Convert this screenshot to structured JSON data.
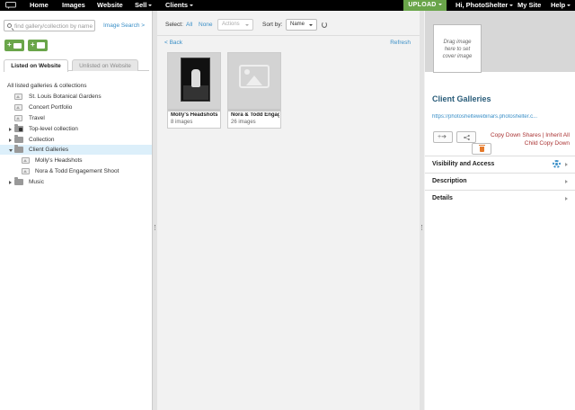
{
  "nav": {
    "items": [
      {
        "label": "Home"
      },
      {
        "label": "Images"
      },
      {
        "label": "Website"
      },
      {
        "label": "Sell"
      },
      {
        "label": "Clients"
      }
    ],
    "upload_label": "UPLOAD",
    "greeting_prefix": "Hi, ",
    "username": "PhotoShelter",
    "my_site": "My Site",
    "help": "Help"
  },
  "sidebar": {
    "search_placeholder": "find gallery/collection by name",
    "image_search": "Image Search >",
    "tabs": [
      {
        "label": "Listed on Website",
        "active": true
      },
      {
        "label": "Unlisted on Website",
        "active": false
      }
    ],
    "tree_header": "All listed galleries & collections",
    "tree": [
      {
        "label": "St. Louis Botanical Gardens",
        "type": "gallery"
      },
      {
        "label": "Concert Portfolio",
        "type": "gallery"
      },
      {
        "label": "Travel",
        "type": "gallery"
      },
      {
        "label": "Top-level collection",
        "type": "collection-locked"
      },
      {
        "label": "Collection",
        "type": "collection"
      },
      {
        "label": "Client Galleries",
        "type": "collection",
        "selected": true
      },
      {
        "label": "Molly's Headshots",
        "type": "gallery"
      },
      {
        "label": "Nora & Todd Engagement Shoot",
        "type": "gallery"
      },
      {
        "label": "Music",
        "type": "collection"
      }
    ]
  },
  "main": {
    "select_label": "Select:",
    "select_all": "All",
    "select_none": "None",
    "actions_label": "Actions",
    "sort_label": "Sort by:",
    "sort_value": "Name",
    "back": "< Back",
    "refresh": "Refresh",
    "cards": [
      {
        "title": "Molly's Headshots",
        "count": "8 images"
      },
      {
        "title": "Nora & Todd Engag...",
        "count": "26 images"
      }
    ]
  },
  "detail": {
    "cover_text": "Drag image here to set cover image",
    "title": "Client Galleries",
    "url": "https://photosheltewebinars.photoshelter.c...",
    "copy_line1": "Copy Down Shares | Inherit All",
    "copy_line2": "Child Copy Down",
    "sections": [
      {
        "label": "Visibility and Access"
      },
      {
        "label": "Description"
      },
      {
        "label": "Details"
      }
    ]
  },
  "colors": {
    "accent": "#6aa54a",
    "link": "#3a8fc7",
    "selected_row": "#dceffa",
    "title": "#2a5d7a",
    "warn": "#a33"
  }
}
